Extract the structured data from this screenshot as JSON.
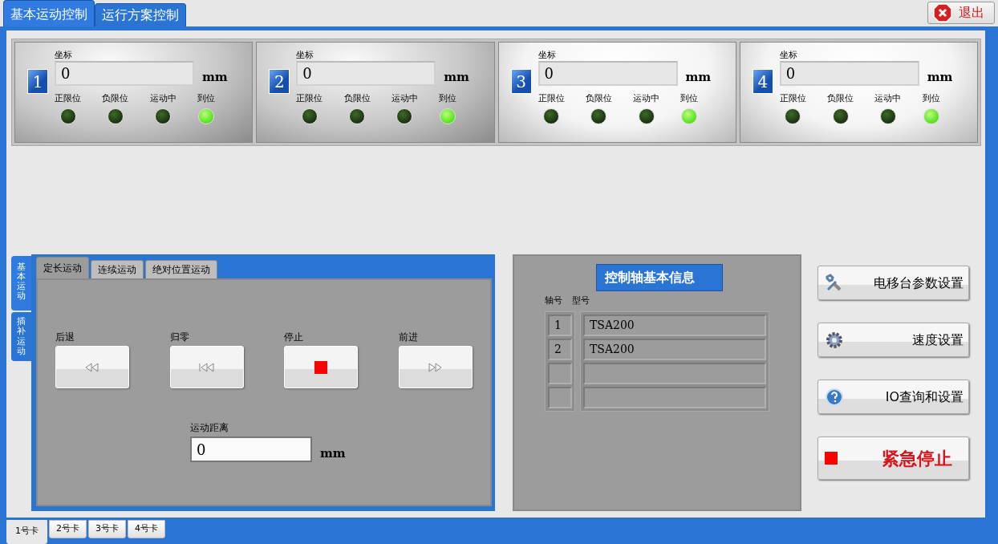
{
  "tabs": [
    {
      "label": "基本运动控制",
      "selected": true
    },
    {
      "label": "运行方案控制",
      "selected": false
    }
  ],
  "exit_button": {
    "label": "退出"
  },
  "axes": [
    {
      "number": "1",
      "kind": "dark",
      "coord_label": "坐标",
      "value": "0",
      "unit": "mm",
      "indicators": [
        {
          "label": "正限位",
          "on": false
        },
        {
          "label": "负限位",
          "on": false
        },
        {
          "label": "运动中",
          "on": false
        },
        {
          "label": "到位",
          "on": true
        }
      ]
    },
    {
      "number": "2",
      "kind": "dark",
      "coord_label": "坐标",
      "value": "0",
      "unit": "mm",
      "indicators": [
        {
          "label": "正限位",
          "on": false
        },
        {
          "label": "负限位",
          "on": false
        },
        {
          "label": "运动中",
          "on": false
        },
        {
          "label": "到位",
          "on": true
        }
      ]
    },
    {
      "number": "3",
      "kind": "light",
      "coord_label": "坐标",
      "value": "0",
      "unit": "mm",
      "indicators": [
        {
          "label": "正限位",
          "on": false
        },
        {
          "label": "负限位",
          "on": false
        },
        {
          "label": "运动中",
          "on": false
        },
        {
          "label": "到位",
          "on": true
        }
      ]
    },
    {
      "number": "4",
      "kind": "light",
      "coord_label": "坐标",
      "value": "0",
      "unit": "mm",
      "indicators": [
        {
          "label": "正限位",
          "on": false
        },
        {
          "label": "负限位",
          "on": false
        },
        {
          "label": "运动中",
          "on": false
        },
        {
          "label": "到位",
          "on": true
        }
      ]
    }
  ],
  "motion_panel": {
    "side_tabs": [
      {
        "label": "基本运动",
        "selected": true
      },
      {
        "label": "插补运动",
        "selected": false
      }
    ],
    "tabs": [
      {
        "label": "定长运动",
        "selected": true
      },
      {
        "label": "连续运动",
        "selected": false
      },
      {
        "label": "绝对位置运动",
        "selected": false
      }
    ],
    "buttons": [
      {
        "label": "后退",
        "kind": "backward"
      },
      {
        "label": "归零",
        "kind": "home"
      },
      {
        "label": "停止",
        "kind": "stop"
      },
      {
        "label": "前进",
        "kind": "forward"
      }
    ],
    "distance": {
      "label": "运动距离",
      "value": "0",
      "unit": "mm"
    }
  },
  "axis_info": {
    "title": "控制轴基本信息",
    "columns": [
      "轴号",
      "型号"
    ],
    "rows": [
      {
        "axis": "1",
        "model": "TSA200"
      },
      {
        "axis": "2",
        "model": "TSA200"
      },
      {},
      {}
    ]
  },
  "actions": [
    {
      "label": "电移台参数设置",
      "kind": "settings"
    },
    {
      "label": "速度设置",
      "kind": "speed"
    },
    {
      "label": "IO查询和设置",
      "kind": "help"
    },
    {
      "label": "紧急停止",
      "kind": "emergency"
    }
  ],
  "card_tabs": [
    {
      "label": "1号卡",
      "selected": true
    },
    {
      "label": "2号卡",
      "selected": false
    },
    {
      "label": "3号卡",
      "selected": false
    },
    {
      "label": "4号卡",
      "selected": false
    }
  ]
}
